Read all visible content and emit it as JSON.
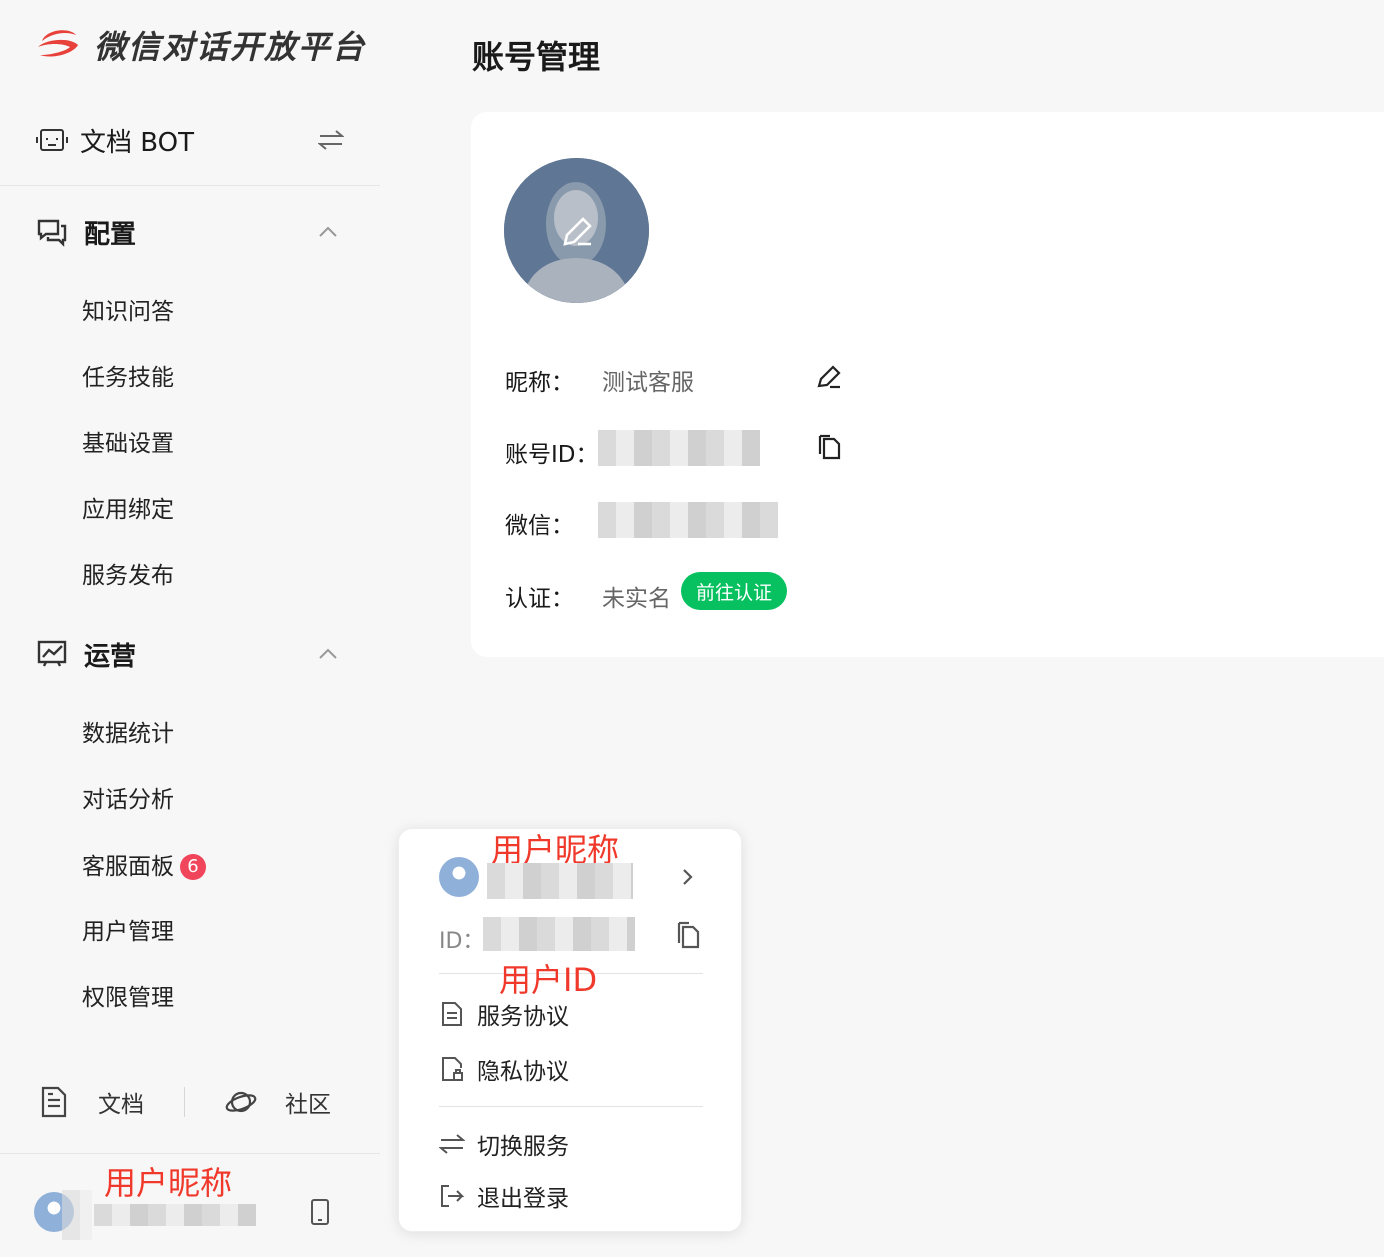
{
  "app": {
    "title": "微信对话开放平台"
  },
  "bot": {
    "name": "文档 BOT"
  },
  "nav": {
    "config": {
      "title": "配置",
      "items": [
        "知识问答",
        "任务技能",
        "基础设置",
        "应用绑定",
        "服务发布"
      ]
    },
    "ops": {
      "title": "运营",
      "items": [
        "数据统计",
        "对话分析",
        "客服面板",
        "用户管理",
        "权限管理"
      ],
      "badge": "6"
    }
  },
  "bottom_links": {
    "docs": "文档",
    "community": "社区"
  },
  "user": {
    "nickname_label": "用户昵称"
  },
  "main": {
    "title": "账号管理",
    "fields": {
      "nickname_label": "昵称：",
      "nickname_value": "测试客服",
      "account_id_label": "账号ID：",
      "wechat_label": "微信：",
      "verify_label": "认证：",
      "verify_value": "未实名",
      "verify_button": "前往认证"
    }
  },
  "popup": {
    "nickname_label": "用户昵称",
    "id_label": "ID：",
    "id_annotation": "用户ID",
    "menu": {
      "service_agreement": "服务协议",
      "privacy_agreement": "隐私协议",
      "switch_service": "切换服务",
      "logout": "退出登录"
    }
  },
  "colors": {
    "accent_green": "#07c160",
    "badge_red": "#f0455a",
    "annotation_red": "#f0392b",
    "brand_red": "#e8403a"
  },
  "icons": [
    "logo-icon",
    "bot-icon",
    "switch-icon",
    "chat-config-icon",
    "chevron-up-icon",
    "chart-icon",
    "doc-icon",
    "planet-icon",
    "phone-icon",
    "edit-icon",
    "copy-icon",
    "chevron-right-icon",
    "privacy-icon",
    "logout-icon"
  ]
}
